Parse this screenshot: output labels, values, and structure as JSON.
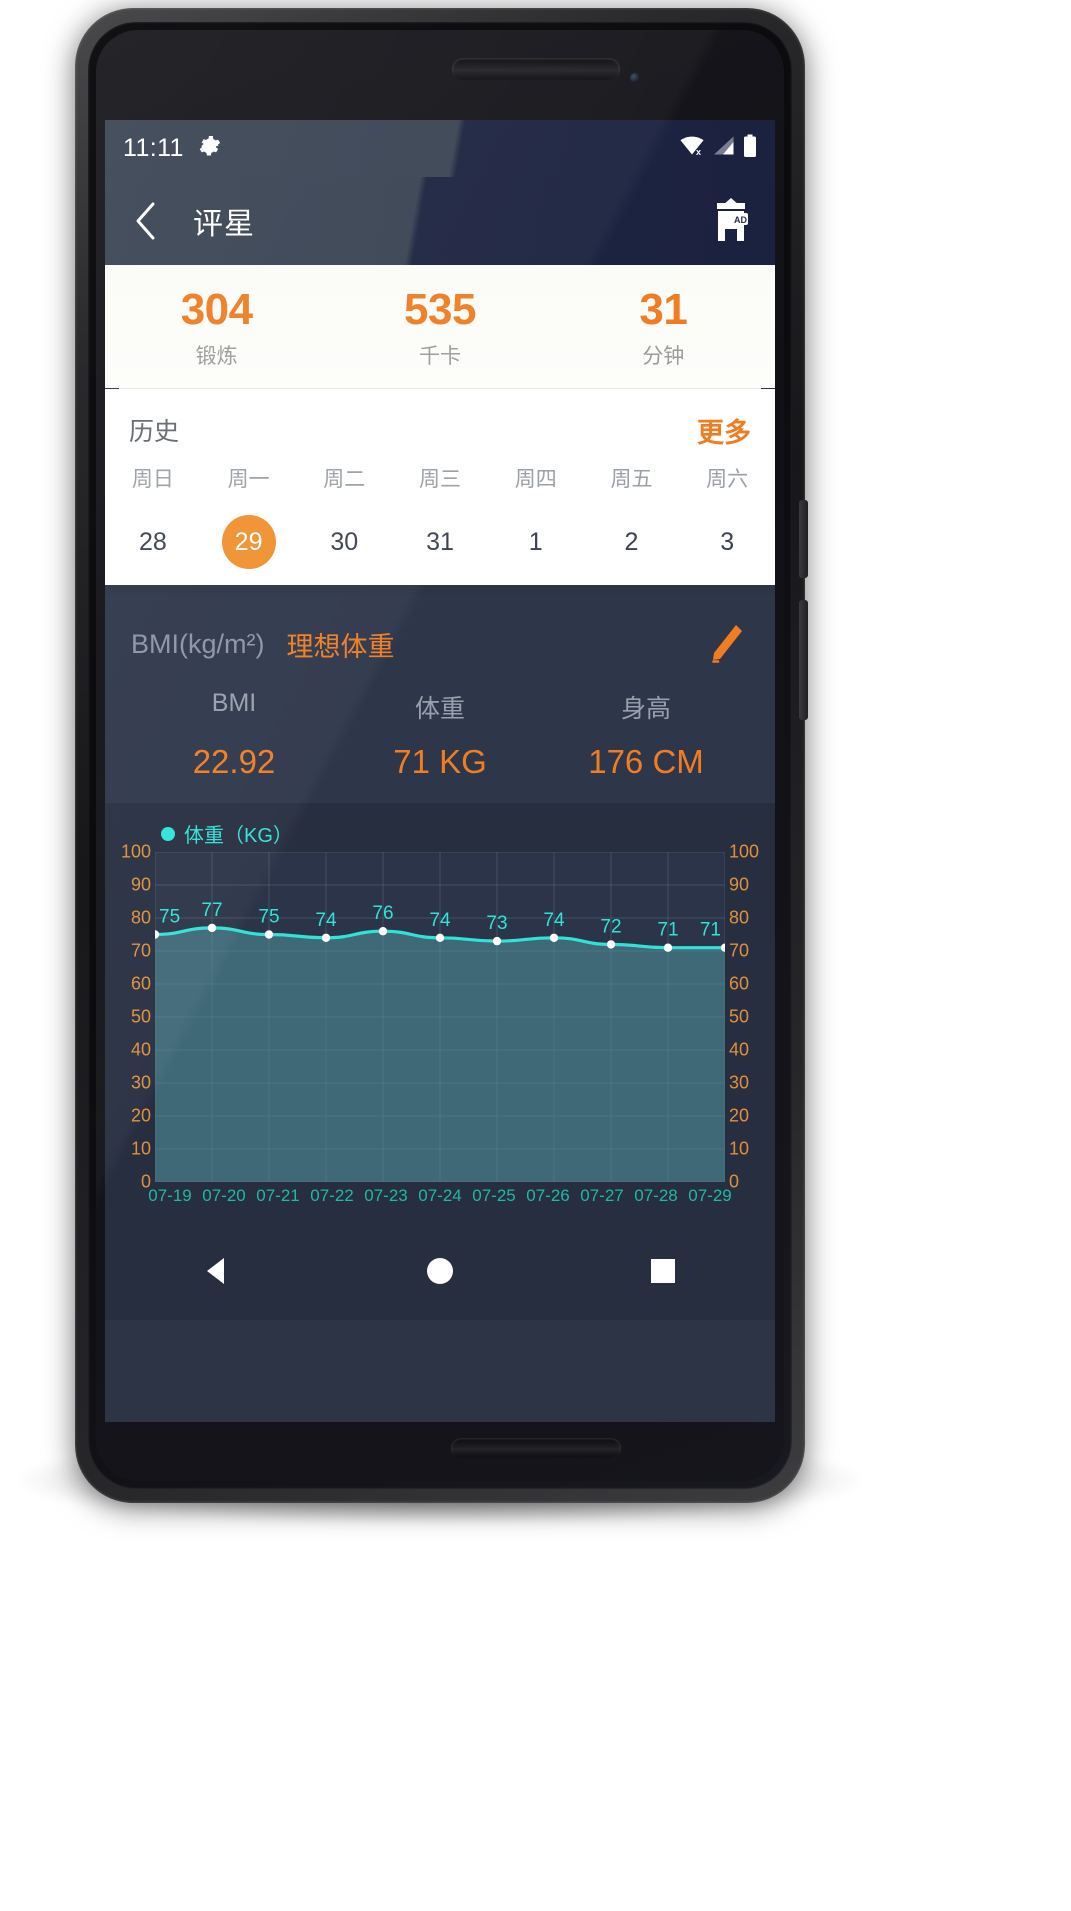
{
  "status_bar": {
    "time": "11:11",
    "icons": [
      "gear-icon",
      "wifi-off-icon",
      "cellular-signal-icon",
      "battery-full-icon"
    ]
  },
  "app_bar": {
    "back_icon": "chevron-left-icon",
    "title": "评星",
    "ad_icon": "ad-badge-icon"
  },
  "summary": {
    "cells": [
      {
        "value": "304",
        "label": "锻炼"
      },
      {
        "value": "535",
        "label": "千卡"
      },
      {
        "value": "31",
        "label": "分钟"
      }
    ]
  },
  "history": {
    "title": "历史",
    "more_label": "更多",
    "weekdays": [
      "周日",
      "周一",
      "周二",
      "周三",
      "周四",
      "周五",
      "周六"
    ],
    "dates": [
      "28",
      "29",
      "30",
      "31",
      "1",
      "2",
      "3"
    ],
    "selected_index": 1
  },
  "bmi": {
    "unit_label": "BMI(kg/m²)",
    "ideal_label": "理想体重",
    "edit_icon": "pencil-edit-icon",
    "labels": [
      "BMI",
      "体重",
      "身高"
    ],
    "values": [
      "22.92",
      "71 KG",
      "176 CM"
    ]
  },
  "nav_bar": {
    "back_icon": "triangle-back-icon",
    "home_icon": "circle-home-icon",
    "recents_icon": "square-recents-icon"
  },
  "colors": {
    "accent_orange": "#f07d22",
    "chart_cyan": "#2fe3d8",
    "axis_orange": "#e0903a",
    "xtick_teal": "#1fb9a6",
    "panel_dark": "#2e364a",
    "chart_bg": "#262e40"
  },
  "chart_data": {
    "type": "area",
    "title": "",
    "legend": [
      "体重（KG）"
    ],
    "legend_position": "top-left",
    "x": [
      "07-19",
      "07-20",
      "07-21",
      "07-22",
      "07-23",
      "07-24",
      "07-25",
      "07-26",
      "07-27",
      "07-28",
      "07-29"
    ],
    "series": [
      {
        "name": "体重（KG）",
        "values": [
          75,
          77,
          75,
          74,
          76,
          74,
          73,
          74,
          72,
          71,
          71
        ]
      }
    ],
    "point_labels": [
      "75",
      "77",
      "75",
      "74",
      "76",
      "74",
      "73",
      "74",
      "72",
      "71",
      "71"
    ],
    "ylim": [
      0,
      100
    ],
    "yticks": [
      100,
      90,
      80,
      70,
      60,
      50,
      40,
      30,
      20,
      10,
      0
    ],
    "ytick_labels_left": [
      "100",
      "90",
      "80",
      "70",
      "60",
      "50",
      "40",
      "30",
      "20",
      "10",
      "0"
    ],
    "ytick_labels_right": [
      "100",
      "90",
      "80",
      "70",
      "60",
      "50",
      "40",
      "30",
      "20",
      "10",
      "0"
    ],
    "xlabel": "",
    "ylabel": "",
    "grid": true
  }
}
